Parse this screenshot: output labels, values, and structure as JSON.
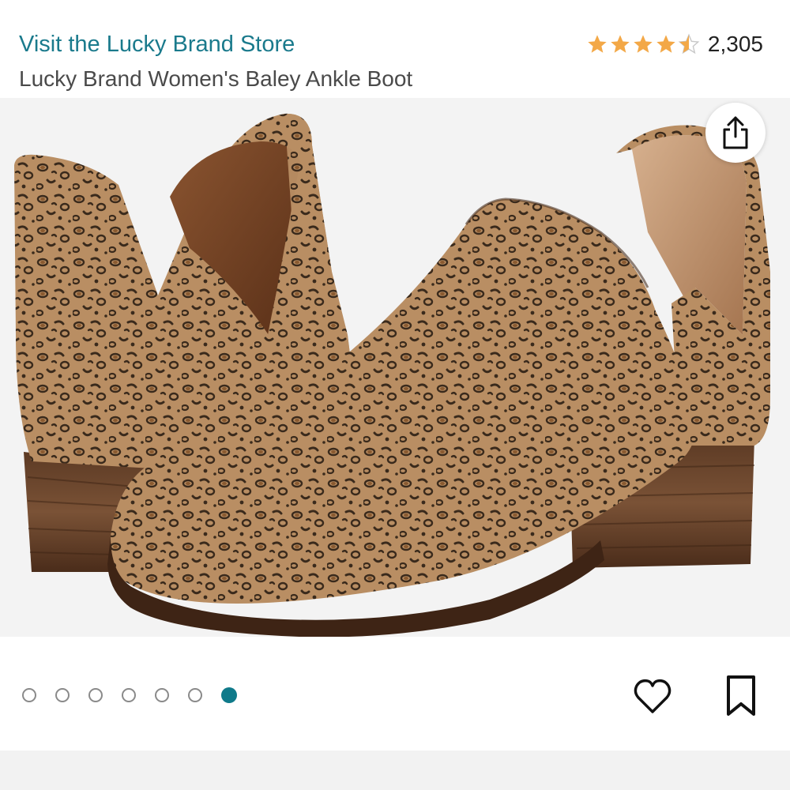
{
  "header": {
    "store_link": "Visit the Lucky Brand Store",
    "product_title": "Lucky Brand Women's Baley Ankle Boot",
    "rating_value": 4.5,
    "rating_count": "2,305"
  },
  "gallery": {
    "image_count": 7,
    "active_index": 6
  },
  "icons": {
    "share": "share-icon",
    "heart": "heart-icon",
    "bookmark": "bookmark-icon",
    "star": "star-icon"
  },
  "colors": {
    "link": "#1a7a8c",
    "star": "#f3a847",
    "active_dot": "#0f7a8a"
  }
}
